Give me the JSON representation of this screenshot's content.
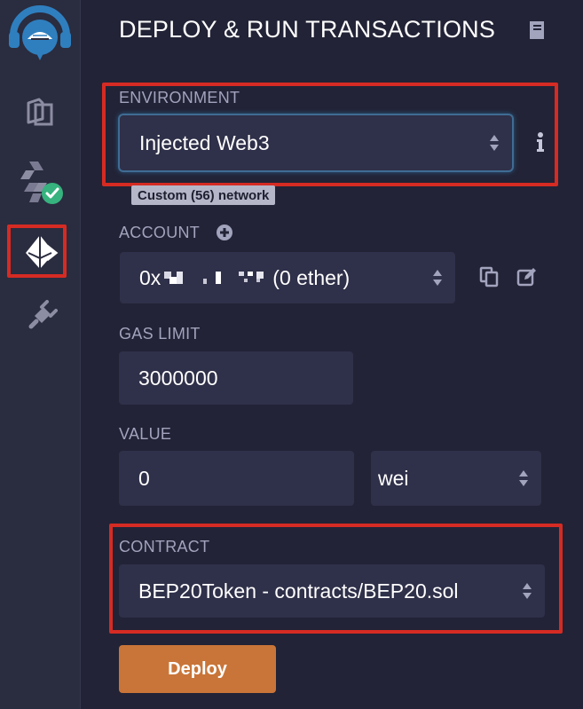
{
  "sidebar": {
    "icons": [
      "remix-logo-icon",
      "file-explorer-icon",
      "solidity-compiler-icon",
      "deploy-run-icon",
      "plugin-manager-icon"
    ]
  },
  "panel": {
    "title": "DEPLOY & RUN TRANSACTIONS"
  },
  "environment": {
    "label": "ENVIRONMENT",
    "value": "Injected Web3",
    "network_badge": "Custom (56) network"
  },
  "account": {
    "label": "ACCOUNT",
    "prefix": "0x",
    "suffix": "(0 ether)"
  },
  "gas_limit": {
    "label": "GAS LIMIT",
    "value": "3000000"
  },
  "value": {
    "label": "VALUE",
    "amount": "0",
    "unit": "wei"
  },
  "contract": {
    "label": "CONTRACT",
    "value": "BEP20Token - contracts/BEP20.sol"
  },
  "deploy": {
    "label": "Deploy"
  },
  "colors": {
    "background": "#222336",
    "sidebar": "#2a2c3f",
    "field": "#2f3049",
    "label": "#a2a3bd",
    "highlight_red": "#d52b23",
    "deploy_orange": "#c97539",
    "check_green": "#36b37e",
    "logo_blue": "#2f7fbf"
  }
}
